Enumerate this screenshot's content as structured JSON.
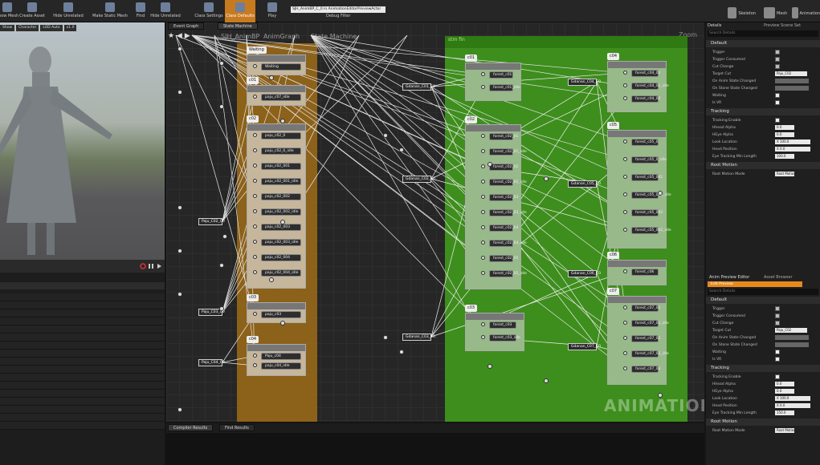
{
  "toolbar": {
    "buttons": [
      {
        "label": "Show Mesh",
        "icon": "mesh-icon"
      },
      {
        "label": "Create Asset",
        "icon": "create-asset-icon"
      },
      {
        "label": "Hide Unrelated",
        "icon": "hide-unrelated-icon"
      },
      {
        "label": "Make Static Mesh",
        "icon": "static-mesh-icon"
      },
      {
        "label": "Find",
        "icon": "find-icon"
      },
      {
        "label": "Hide Unrelated",
        "icon": "hide-unrelated-icon"
      },
      {
        "label": "Class Settings",
        "icon": "class-settings-icon"
      },
      {
        "label": "Class Defaults",
        "icon": "class-defaults-icon"
      },
      {
        "label": "Play",
        "icon": "play-icon"
      }
    ],
    "debug_select": "SJH_AnimBP_C_0 in AnimationEditorPreviewActor",
    "debug_label": "Debug Filter",
    "mode_buttons": [
      {
        "label": "Skeleton"
      },
      {
        "label": "Mesh"
      },
      {
        "label": "Animation"
      }
    ]
  },
  "viewport": {
    "chips": [
      "Show",
      "Character",
      "LOD Auto",
      "x1.0"
    ]
  },
  "graph": {
    "tabs": [
      "Event Graph",
      "State Machine"
    ],
    "breadcrumb": [
      "SJH_AnimBP",
      "AnimGraph",
      "State Machine"
    ],
    "zoom": "Zoom -4",
    "watermark": "ANIMATION",
    "left_states": [
      {
        "tag": "Waiting",
        "nodes": [
          "Waiting"
        ]
      },
      {
        "tag": "c01",
        "nodes": [
          "paju_c07_idle"
        ]
      },
      {
        "tag": "c02",
        "nodes": [
          "paju_c02_0",
          "paju_c02_0_idle",
          "paju_c02_001",
          "paju_c02_001_idle",
          "paju_c02_002",
          "paju_c02_002_idle",
          "paju_c02_003",
          "paju_c02_003_idle",
          "paju_c02_004",
          "paju_c02_004_idle"
        ]
      },
      {
        "tag": "c03",
        "nodes": [
          "paju_c03"
        ]
      },
      {
        "tag": "c04",
        "nodes": [
          "Paju_c04",
          "paju_c04_idle"
        ]
      }
    ],
    "left_conduits": [
      "Paju_C02_C0",
      "Paju_C03_C0",
      "Paju_C04_C0"
    ],
    "green_title": "stm fin",
    "green_states": [
      {
        "tag": "c01",
        "nodes": [
          "forest_c01",
          "forest_c01_idle"
        ]
      },
      {
        "tag": "c02",
        "nodes": [
          "forest_c02_01",
          "forest_c02_01_idle",
          "forest_c02_02",
          "forest_c02_02_idle",
          "forest_c02_03",
          "forest_c02_03_idle",
          "forest_c02_04",
          "forest_c02_04_idle",
          "forest_c02_05",
          "forest_c02_05_idle"
        ]
      },
      {
        "tag": "c03",
        "nodes": [
          "forest_c03",
          "forest_c03_idle"
        ]
      },
      {
        "tag": "c04",
        "nodes": [
          "forest_c04_01",
          "forest_c04_01_idle",
          "forest_c04_02"
        ]
      },
      {
        "tag": "c05",
        "nodes": [
          "forest_c05_0",
          "forest_c05_0_idle",
          "forest_c05_001",
          "forest_c05_001_idle",
          "forest_c05_002",
          "forest_c05_002_idle"
        ]
      },
      {
        "tag": "c06",
        "nodes": [
          "forest_c06"
        ]
      },
      {
        "tag": "c07",
        "nodes": [
          "forest_c07_01",
          "forest_c07_01_idle",
          "forest_c07_02",
          "forest_c07_02_idle",
          "forest_c07_03"
        ]
      }
    ],
    "green_conduits": [
      "Gdanan_C01_C0",
      "Gdanan_C02_C0",
      "Gdanan_C03_C0",
      "Gdanan_C04_C0",
      "Gdanan_C05_C0",
      "Gdanan_C06_C0",
      "Gdanan_C07_C0"
    ]
  },
  "bottom": {
    "tabs": [
      "Compiler Results",
      "Find Results"
    ]
  },
  "details": {
    "tabs": [
      "Details",
      "Preview Scene Set"
    ],
    "search": "Search Details",
    "default_title": "Default",
    "default_rows": [
      {
        "label": "Trigger",
        "type": "check",
        "checked": false
      },
      {
        "label": "Trigger Consumed",
        "type": "check",
        "checked": false
      },
      {
        "label": "Cut Change",
        "type": "check",
        "checked": false
      },
      {
        "label": "Target Cut",
        "type": "select",
        "value": "Paju_C02"
      },
      {
        "label": "On Anim State Changed",
        "type": "bar",
        "value": ""
      },
      {
        "label": "On Stone State Changed",
        "type": "bar",
        "value": ""
      },
      {
        "label": "Waiting",
        "type": "check",
        "checked": true
      },
      {
        "label": "Is VR",
        "type": "check",
        "checked": true
      }
    ],
    "tracking_title": "Tracking",
    "tracking_rows": [
      {
        "label": "Tracking Enable",
        "type": "check",
        "checked": true
      },
      {
        "label": "Hhead Alpha",
        "type": "num",
        "value": "0.0"
      },
      {
        "label": "HEye Alpha",
        "type": "num",
        "value": "0.0"
      },
      {
        "label": "Look Location",
        "type": "vec",
        "value": "X 100.0"
      },
      {
        "label": "Head Position",
        "type": "vec",
        "value": "X 0.0"
      },
      {
        "label": "Eye Tracking Min Length",
        "type": "num",
        "value": "100.0"
      }
    ],
    "root_title": "Root Motion",
    "root_rows": [
      {
        "label": "Root Motion Mode",
        "value": "Root Motion from Montages Only"
      }
    ],
    "preview_tabs": [
      "Anim Preview Editor",
      "Asset Browser"
    ],
    "edit_preview": "Edit Preview",
    "preview_search": "Search Details",
    "preview_default_title": "Default",
    "preview_default_rows": [
      {
        "label": "Trigger",
        "type": "check",
        "checked": false
      },
      {
        "label": "Trigger Consumed",
        "type": "check",
        "checked": false
      },
      {
        "label": "Cut Change",
        "type": "check",
        "checked": false
      },
      {
        "label": "Target Cut",
        "type": "select",
        "value": "Paju_C02"
      },
      {
        "label": "On Anim State Changed",
        "type": "bar",
        "value": ""
      },
      {
        "label": "On Stone State Changed",
        "type": "bar",
        "value": ""
      },
      {
        "label": "Waiting",
        "type": "check",
        "checked": true
      },
      {
        "label": "Is VR",
        "type": "check",
        "checked": true
      }
    ],
    "preview_tracking_title": "Tracking",
    "preview_tracking_rows": [
      {
        "label": "Tracking Enable",
        "type": "check",
        "checked": true
      },
      {
        "label": "Hhead Alpha",
        "type": "num",
        "value": "0.0"
      },
      {
        "label": "HEye Alpha",
        "type": "num",
        "value": "0.0"
      },
      {
        "label": "Look Location",
        "type": "vec",
        "value": "X 100.0"
      },
      {
        "label": "Head Position",
        "type": "vec",
        "value": "X 0.0"
      },
      {
        "label": "Eye Tracking Min Length",
        "type": "num",
        "value": "150.0"
      }
    ],
    "preview_root_title": "Root Motion",
    "preview_root_rows": [
      {
        "label": "Root Motion Mode",
        "value": "Root Motion from Montages Only"
      }
    ]
  }
}
